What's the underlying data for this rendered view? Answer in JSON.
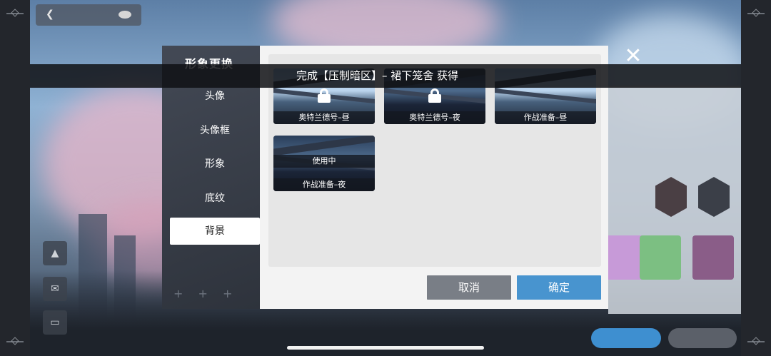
{
  "dialog": {
    "title": "形象更换",
    "nav": [
      {
        "label": "头像"
      },
      {
        "label": "头像框"
      },
      {
        "label": "形象"
      },
      {
        "label": "底纹"
      },
      {
        "label": "背景",
        "active": true
      }
    ],
    "backgrounds": [
      {
        "name": "奥特兰德号–昼",
        "locked": true
      },
      {
        "name": "奥特兰德号–夜",
        "locked": true
      },
      {
        "name": "作战准备–昼",
        "locked": false
      },
      {
        "name": "作战准备–夜",
        "locked": false,
        "in_use_label": "使用中"
      }
    ],
    "cancel_label": "取消",
    "confirm_label": "确定",
    "footer_plus": "+ + +"
  },
  "toast": {
    "text": "完成【压制暗区】– 裙下笼舍 获得"
  },
  "colors": {
    "confirm": "#4894cf",
    "cancel": "#797e86",
    "active_nav_bg": "#ffffff"
  },
  "icons": {
    "close": "close-x-icon",
    "lock": "lock-icon",
    "back": "back-arrow-icon",
    "eye": "eye-icon"
  }
}
